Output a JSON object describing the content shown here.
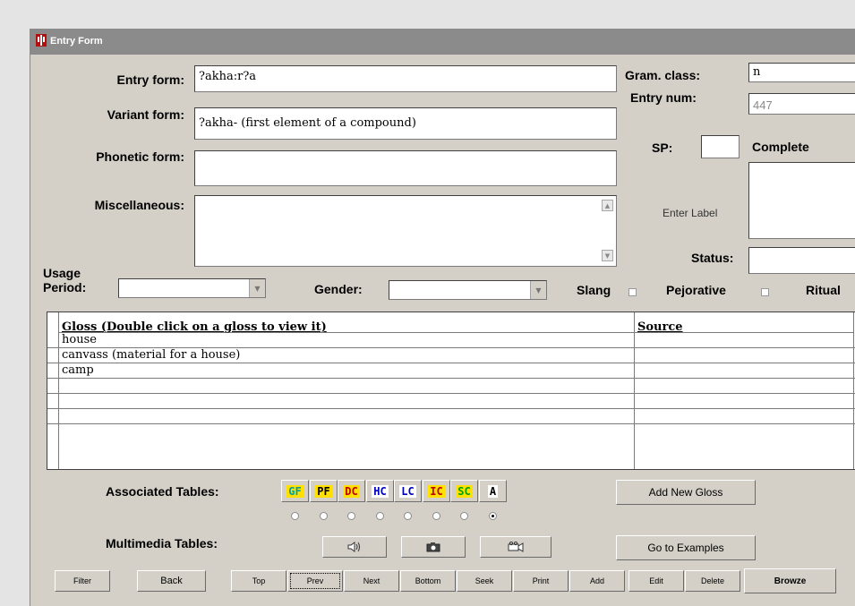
{
  "window": {
    "title": "Entry Form"
  },
  "labels": {
    "entry_form": "Entry form:",
    "variant_form": "Variant form:",
    "phonetic_form": "Phonetic form:",
    "miscellaneous": "Miscellaneous:",
    "usage_line1": "Usage",
    "usage_line2": "Period:",
    "gender": "Gender:",
    "slang": "Slang",
    "pejorative": "Pejorative",
    "ritual": "Ritual",
    "gram_class": "Gram. class:",
    "entry_num": "Entry num:",
    "sp": "SP:",
    "complete": "Complete",
    "enter_label": "Enter Label",
    "status": "Status:",
    "associated_tables": "Associated Tables:",
    "multimedia_tables": "Multimedia Tables:"
  },
  "fields": {
    "entry_form": "?akha:r?a",
    "variant_form": "?akha- (first element of a compound)",
    "phonetic_form": "",
    "miscellaneous": "",
    "usage_period": "",
    "gender": "",
    "gram_class": "n",
    "entry_num": "447",
    "sp": "",
    "complete": "",
    "status": ""
  },
  "grid": {
    "headers": {
      "gloss": "Gloss      (Double click on a gloss to view it)",
      "source": "Source"
    },
    "rows": [
      {
        "gloss": "house",
        "source": ""
      },
      {
        "gloss": "canvass (material for a house)",
        "source": ""
      },
      {
        "gloss": "camp",
        "source": ""
      },
      {
        "gloss": "",
        "source": ""
      },
      {
        "gloss": "",
        "source": ""
      },
      {
        "gloss": "",
        "source": ""
      }
    ]
  },
  "associated_tables": [
    {
      "code": "GF",
      "color": "#00a0a0",
      "bg": "#ffe000",
      "selected": false
    },
    {
      "code": "PF",
      "color": "#000000",
      "bg": "#ffe000",
      "selected": false
    },
    {
      "code": "DC",
      "color": "#c00000",
      "bg": "#ffe000",
      "selected": false
    },
    {
      "code": "HC",
      "color": "#0000c0",
      "bg": "#ffffff",
      "selected": false
    },
    {
      "code": "LC",
      "color": "#0000c0",
      "bg": "#ffffff",
      "selected": false
    },
    {
      "code": "IC",
      "color": "#c00000",
      "bg": "#ffe000",
      "selected": false
    },
    {
      "code": "SC",
      "color": "#00a000",
      "bg": "#ffe000",
      "selected": false
    },
    {
      "code": "A",
      "color": "#000000",
      "bg": "#ffffff",
      "selected": true
    }
  ],
  "multimedia_icons": [
    "speaker-icon",
    "camera-icon",
    "video-camera-icon"
  ],
  "buttons": {
    "add_new_gloss": "Add  New Gloss",
    "go_to_examples": "Go to Examples",
    "filter": "Filter",
    "back": "Back",
    "top": "Top",
    "prev": "Prev",
    "next": "Next",
    "bottom": "Bottom",
    "seek": "Seek",
    "print": "Print",
    "add": "Add",
    "edit": "Edit",
    "delete": "Delete",
    "browse": "Browze"
  }
}
